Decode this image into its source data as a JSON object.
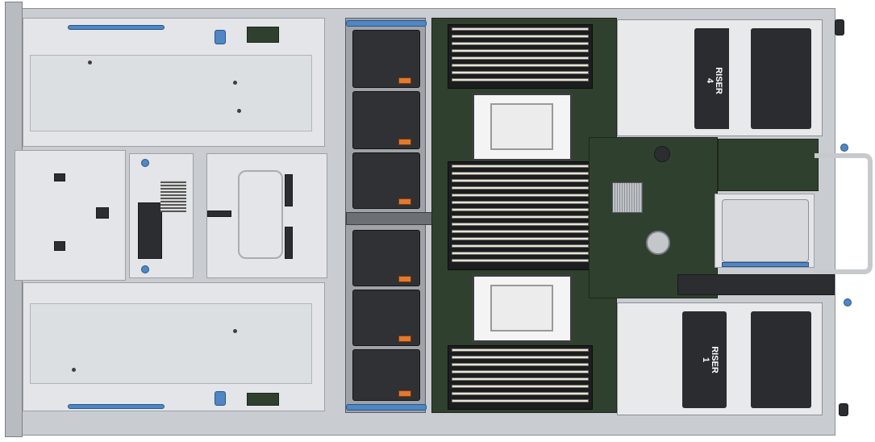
{
  "risers": [
    {
      "label": "RISER\n4"
    },
    {
      "label": "RISER\n1"
    }
  ],
  "colors": {
    "chassis": "#c9ccd0",
    "fan": "#2f3134",
    "fan_label": "#e3792c",
    "touchpoint_blue": "#4f86c4",
    "motherboard": "#30402e"
  }
}
